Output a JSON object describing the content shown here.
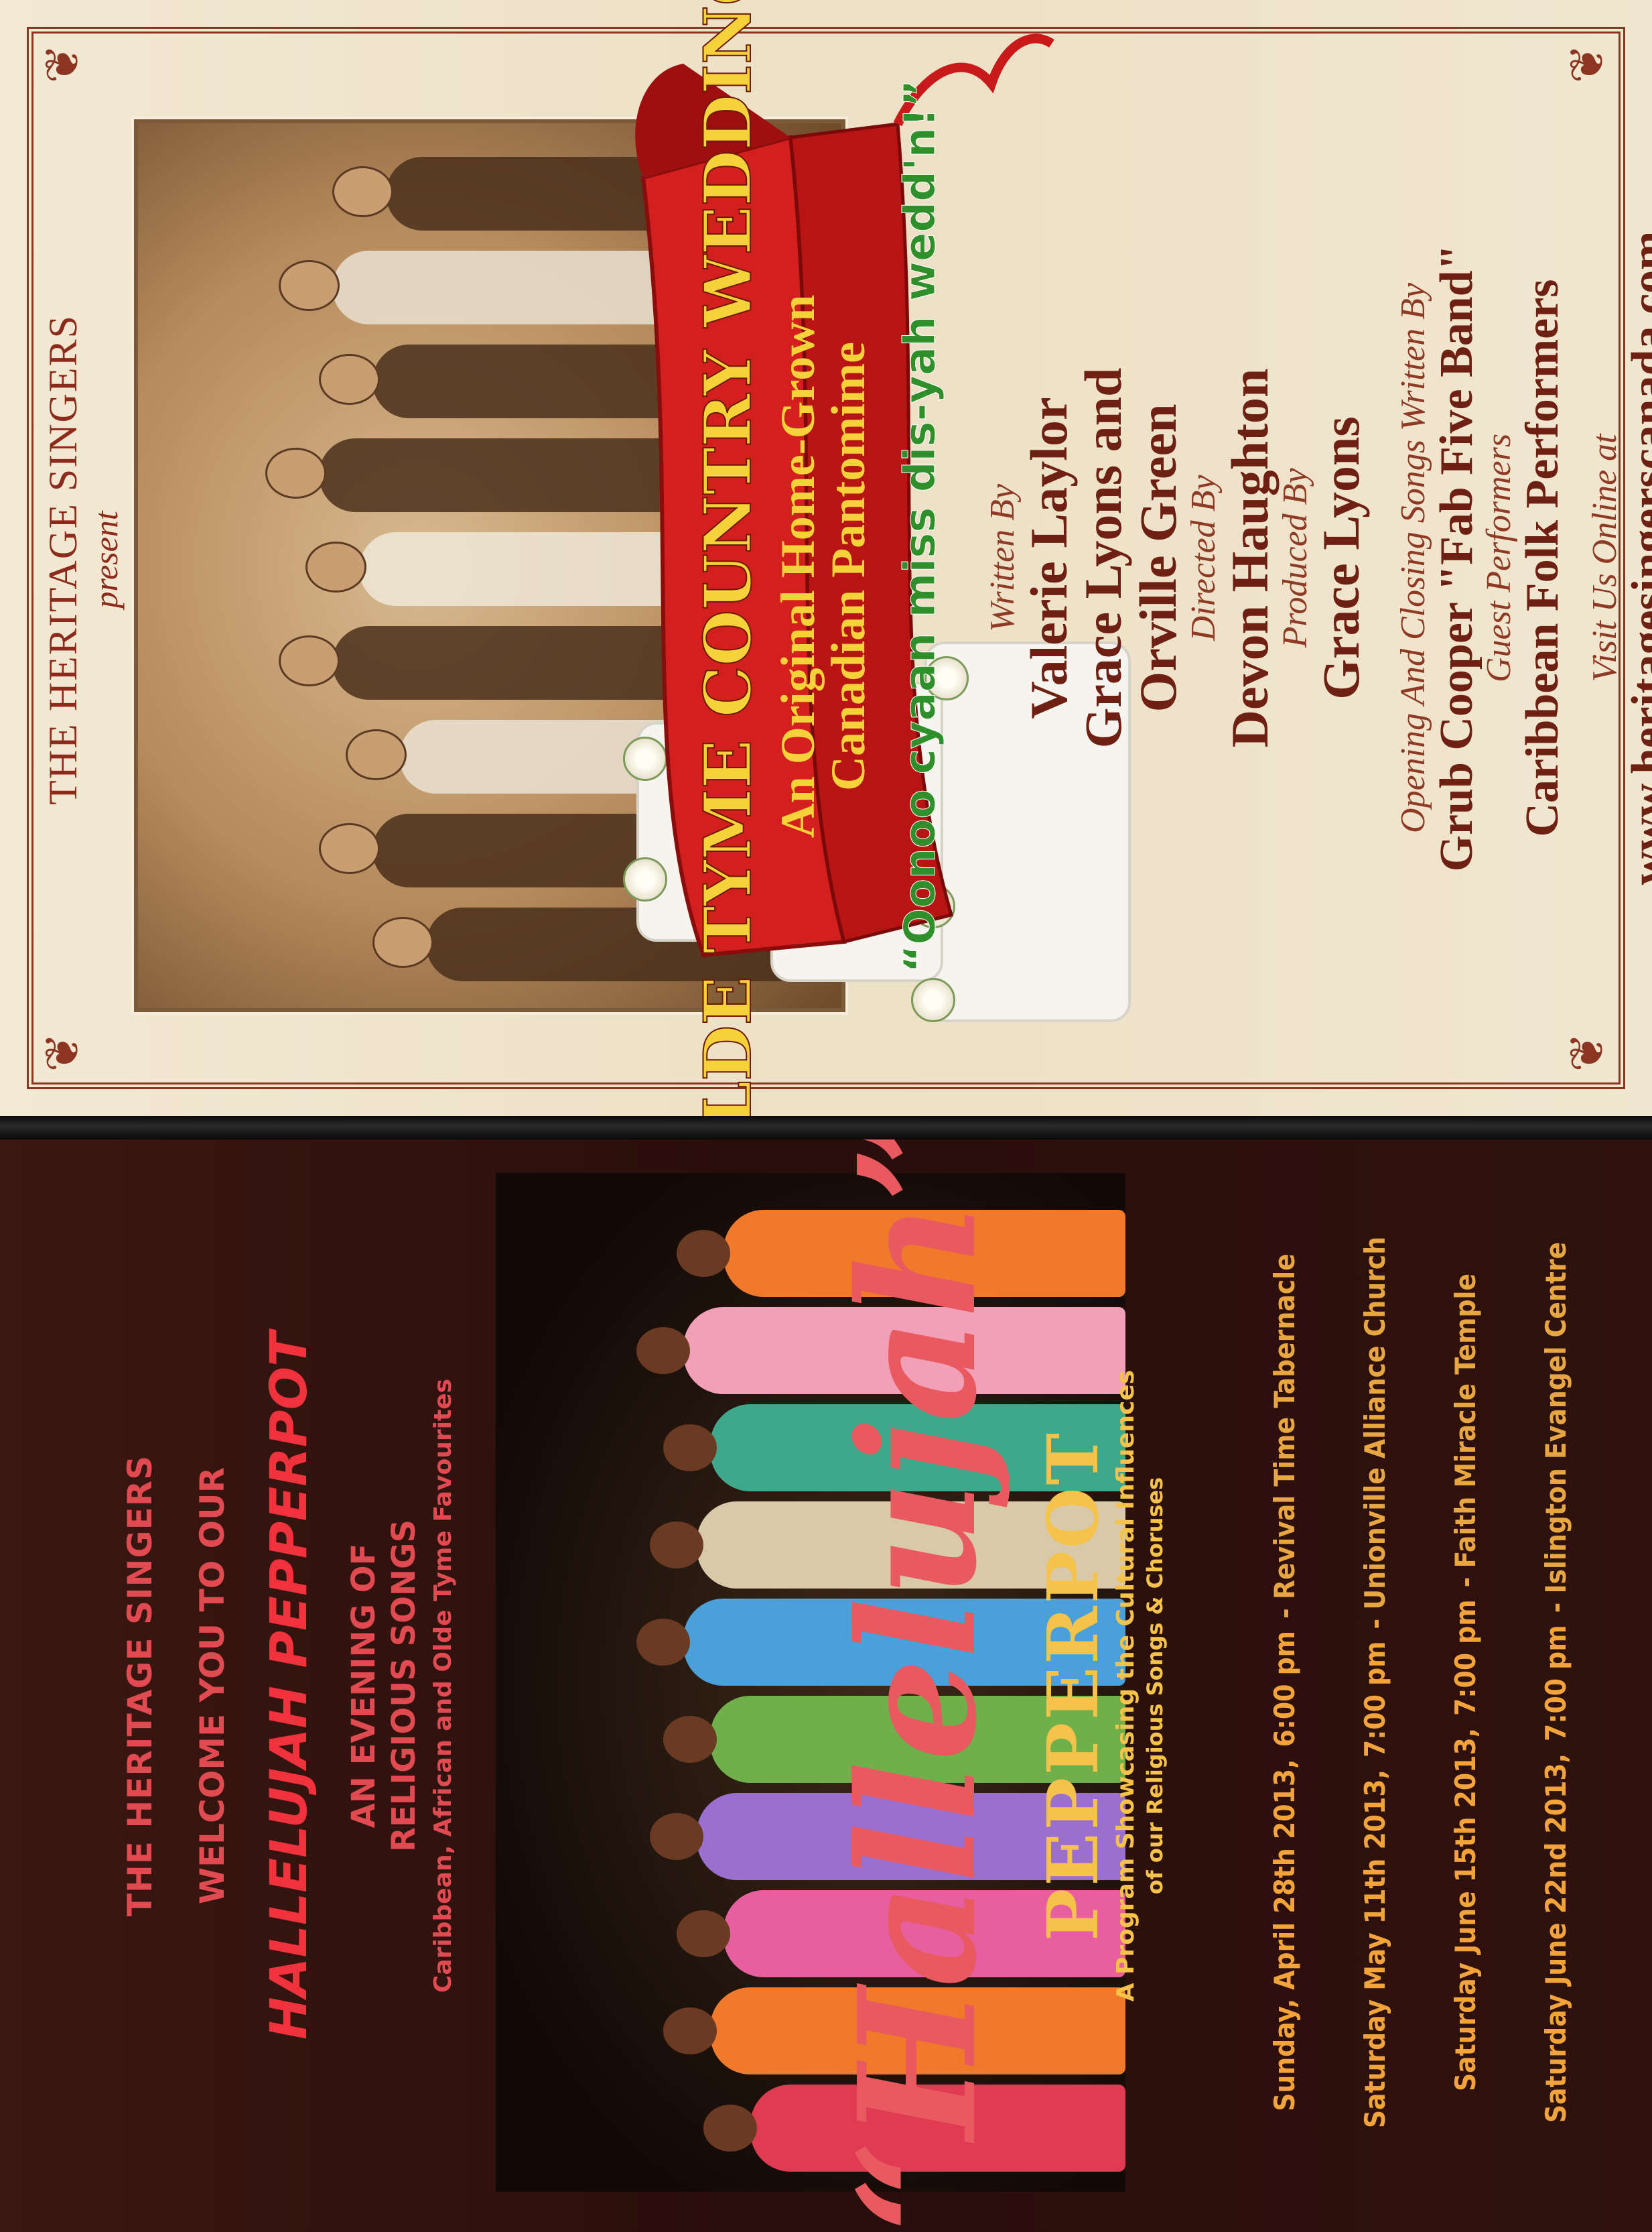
{
  "wedding": {
    "presenter": "THE HERITAGE SINGERS",
    "present": "present",
    "title": "OLDE TYME COUNTRY WEDDING",
    "subtitle_line1": "An Original Home-Grown",
    "subtitle_line2": "Canadian Pantomime",
    "tagline": "“Oonoo cyaan miss dis-yah wedd'n!”",
    "written_by_label": "Written By",
    "writer1": "Valerie Laylor",
    "writer2": "Grace Lyons and",
    "writer3": "Orville Green",
    "directed_by_label": "Directed By",
    "director": "Devon Haughton",
    "produced_by_label": "Produced By",
    "producer": "Grace Lyons",
    "songs_label": "Opening And Closing Songs Written By",
    "songwriter": "Grub Cooper \"Fab Five Band\"",
    "guest_label": "Guest Performers",
    "guests": "Caribbean Folk Performers",
    "visit_label": "Visit Us Online at",
    "website": "www.heritagesingerscanada.com"
  },
  "pepperpot": {
    "line1": "THE HERITAGE SINGERS",
    "line2": "WELCOME YOU TO OUR",
    "line3": "HALLELUJAH PEPPERPOT",
    "line4a": "AN EVENING OF",
    "line4b": "RELIGIOUS SONGS",
    "line5": "Caribbean, African and Olde Tyme Favourites",
    "script_title": "“Hallelujah”",
    "pepperpot": "PEPPERPOT",
    "sub1": "A Program Showcasing the Cultural Influences",
    "sub2": "of our Religious Songs & Choruses",
    "dates": [
      {
        "day": "Sunday, April 28th 2013,",
        "time": "6:00 pm",
        "venue": "-  Revival Time Tabernacle"
      },
      {
        "day": "Saturday May 11th 2013,",
        "time": "7:00 pm",
        "venue": "-  Unionville Alliance Church"
      },
      {
        "day": "Saturday June 15th 2013,",
        "time": "7:00 pm",
        "venue": "-  Faith Miracle Temple"
      },
      {
        "day": "Saturday June 22nd 2013,",
        "time": "7:00 pm",
        "venue": "-  Islington Evangel Centre"
      }
    ]
  }
}
